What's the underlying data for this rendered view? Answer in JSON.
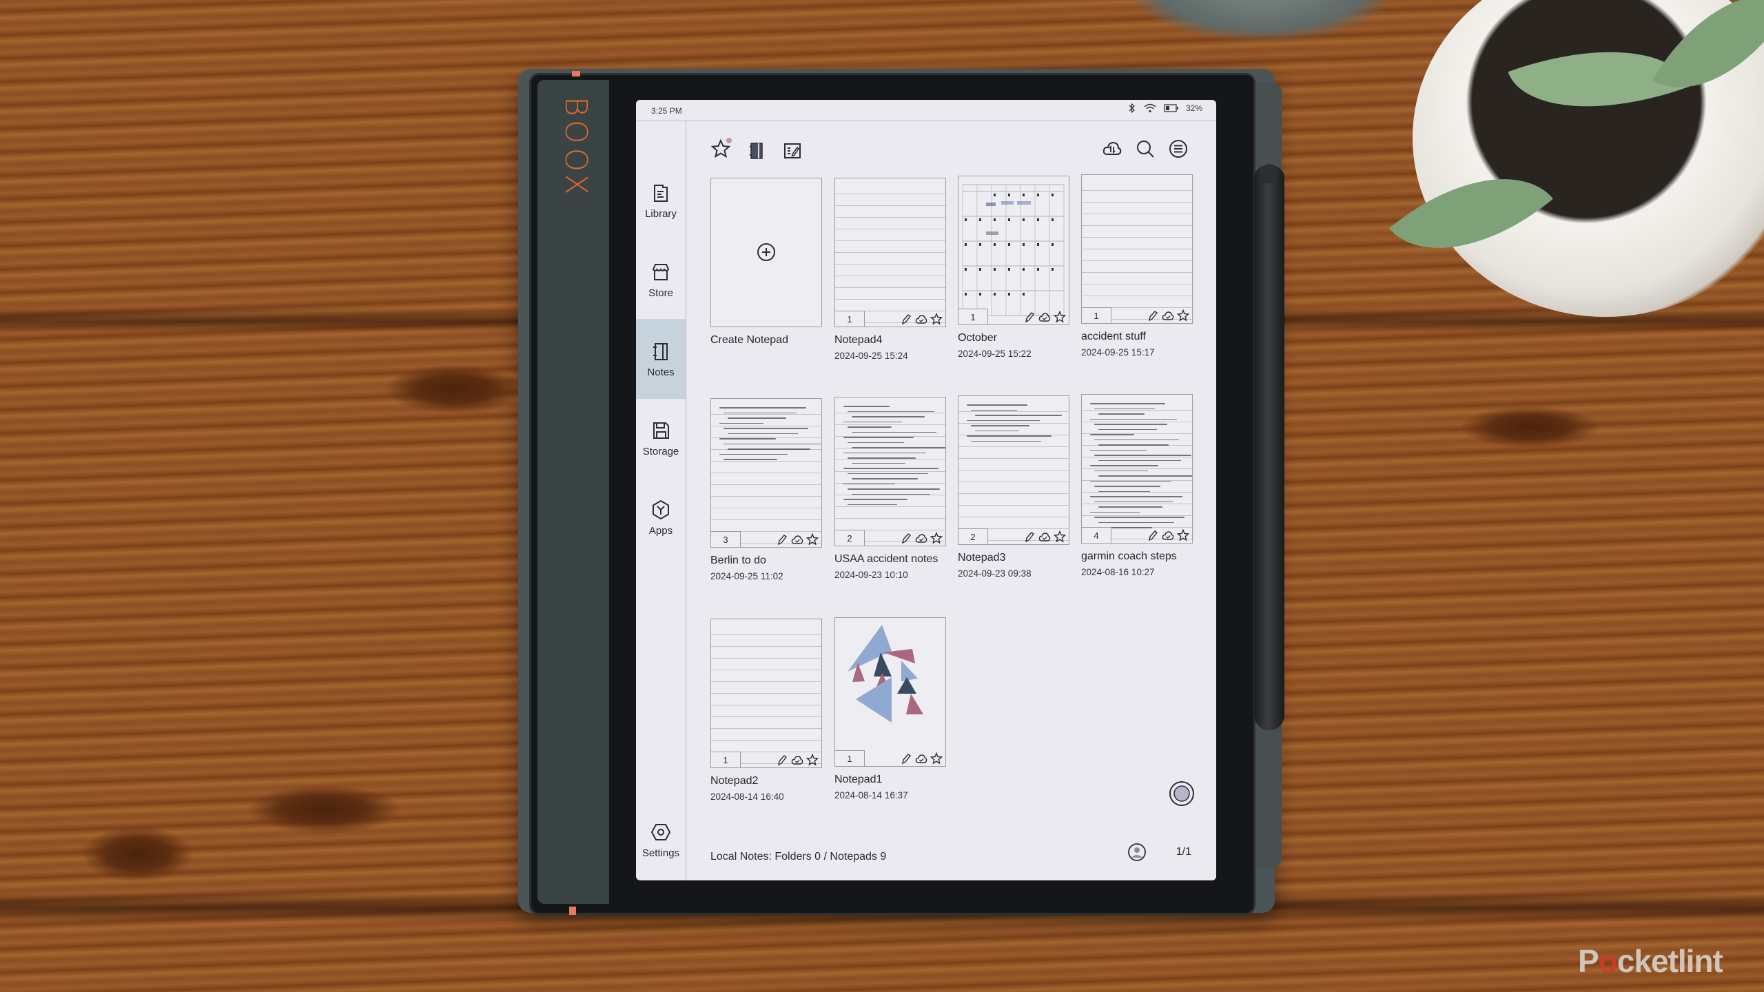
{
  "device": {
    "brand": "BOOX"
  },
  "status_bar": {
    "time": "3:25 PM",
    "battery": "32%",
    "icons": [
      "bluetooth-icon",
      "wifi-icon",
      "battery-icon"
    ]
  },
  "sidebar": {
    "items": [
      {
        "label": "Library",
        "icon": "library-icon",
        "active": false
      },
      {
        "label": "Store",
        "icon": "store-icon",
        "active": false
      },
      {
        "label": "Notes",
        "icon": "notes-icon",
        "active": true
      },
      {
        "label": "Storage",
        "icon": "storage-icon",
        "active": false
      },
      {
        "label": "Apps",
        "icon": "apps-icon",
        "active": false
      }
    ],
    "settings_label": "Settings"
  },
  "toolbar": {
    "left_icons": [
      "star-icon",
      "notebook-icon",
      "edit-list-icon"
    ],
    "right_icons": [
      "cloud-sync-icon",
      "search-icon",
      "menu-icon"
    ]
  },
  "notes": {
    "create_label": "Create Notepad",
    "items": [
      {
        "title": "Notepad4",
        "date": "2024-09-25 15:24",
        "pages": "1"
      },
      {
        "title": "October",
        "date": "2024-09-25 15:22",
        "pages": "1"
      },
      {
        "title": "accident stuff",
        "date": "2024-09-25 15:17",
        "pages": "1"
      },
      {
        "title": "Berlin to do",
        "date": "2024-09-25 11:02",
        "pages": "3"
      },
      {
        "title": "USAA accident notes",
        "date": "2024-09-23 10:10",
        "pages": "2"
      },
      {
        "title": "Notepad3",
        "date": "2024-09-23 09:38",
        "pages": "2"
      },
      {
        "title": "garmin coach steps",
        "date": "2024-08-16 10:27",
        "pages": "4"
      },
      {
        "title": "Notepad2",
        "date": "2024-08-14 16:40",
        "pages": "1"
      },
      {
        "title": "Notepad1",
        "date": "2024-08-14 16:37",
        "pages": "1"
      }
    ]
  },
  "footer": {
    "summary": "Local Notes: Folders 0 / Notepads 9",
    "page_indicator": "1/1"
  },
  "watermark": {
    "prefix": "P",
    "accent": "o",
    "suffix": "cketlint"
  },
  "colors": {
    "brand_orange": "#d9692d",
    "active_nav": "#c6d3dc",
    "screen_bg": "#eceaf1"
  }
}
